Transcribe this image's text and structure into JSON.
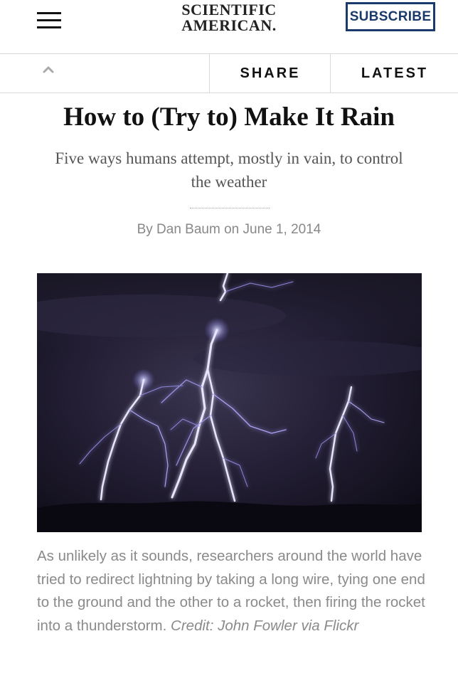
{
  "header": {
    "logo_line1": "SCIENTIFIC",
    "logo_line2": "AMERICAN.",
    "subscribe_label": "SUBSCRIBE",
    "menu_icon": "hamburger-menu-icon"
  },
  "nav": {
    "up_icon": "chevron-up-icon",
    "share_label": "SHARE",
    "latest_label": "LATEST"
  },
  "article": {
    "headline": "How to (Try to) Make It Rain",
    "dek": "Five ways humans attempt, mostly in vain, to control the weather",
    "byline": "By Dan Baum on June 1, 2014",
    "image_subject": "lightning storm at night",
    "caption": "As unlikely as it sounds, researchers around the world have tried to redirect lightning by taking a long wire, tying one end to the ground and the other to a rocket, then firing the rocket into a thunderstorm.",
    "credit": "Credit: John Fowler via Flickr"
  },
  "colors": {
    "brand_blue": "#1a3a6b",
    "text_dark": "#111111",
    "text_gray": "#8a8a8a"
  }
}
